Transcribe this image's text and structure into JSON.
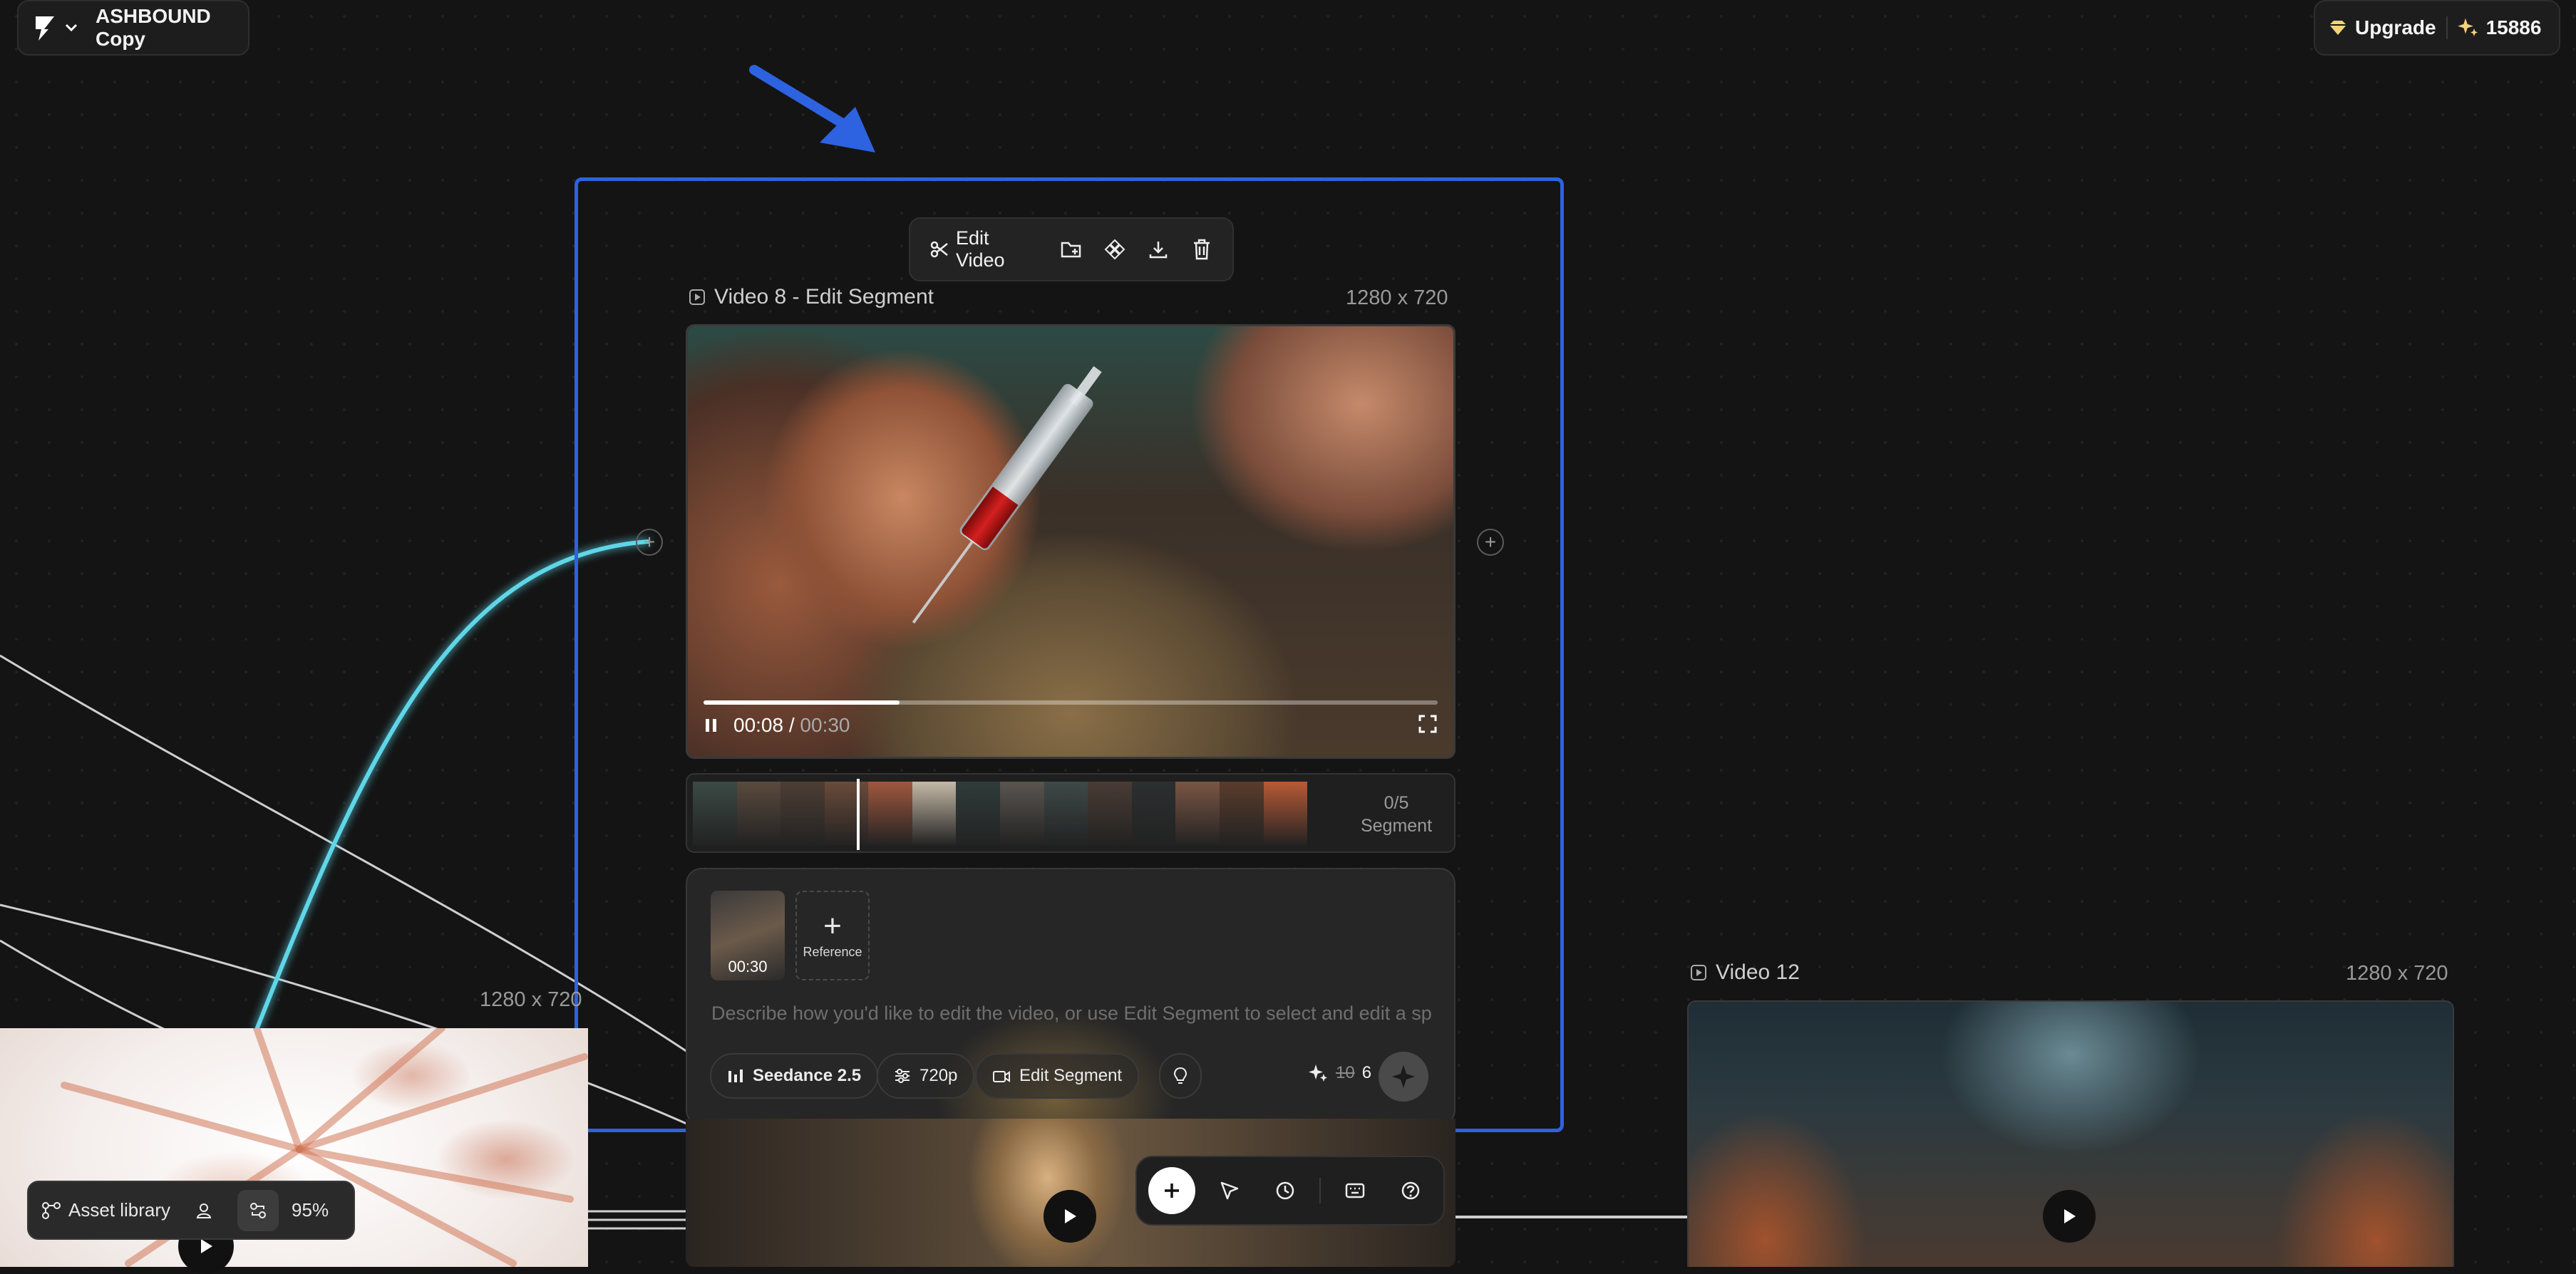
{
  "app": {
    "project_name": "ASHBOUND Copy",
    "upgrade_label": "Upgrade",
    "credits": "15886"
  },
  "node_toolbar": {
    "edit_video_label": "Edit Video",
    "icons": [
      "folder-add-icon",
      "component-icon",
      "download-icon",
      "trash-icon"
    ]
  },
  "selected_node": {
    "title": "Video 8 - Edit Segment",
    "dimensions": "1280 x 720",
    "player": {
      "time_current": "00:08",
      "time_separator": " / ",
      "time_total": "00:30",
      "progress_fraction": 0.267
    },
    "filmstrip": {
      "segment_count": "0/5",
      "segment_label": "Segment",
      "frame_colors": [
        "#3b4a44",
        "#5a4a3e",
        "#4d3e34",
        "#6a4b3a",
        "#a0573e",
        "#c4b9a6",
        "#2f3c3a",
        "#5a5550",
        "#3e4a48",
        "#4a3b34",
        "#2c2f30",
        "#7a5644",
        "#5a3c2c",
        "#b85a36"
      ]
    },
    "prompt_panel": {
      "reference_thumb_time": "00:30",
      "reference_add_label": "Reference",
      "input_placeholder": "Describe how you'd like to edit the video, or use Edit Segment to select and edit a sp...",
      "input_value": "",
      "model_label": "Seedance 2.5",
      "resolution_label": "720p",
      "edit_segment_label": "Edit Segment",
      "cost_original": "10",
      "cost_current": "6"
    }
  },
  "left_node": {
    "dimensions": "1280 x 720"
  },
  "right_node": {
    "title": "Video 12",
    "dimensions": "1280 x 720"
  },
  "bottom_bar": {
    "asset_library_label": "Asset library",
    "zoom": "95%"
  },
  "colors": {
    "selection_border": "#2d63e0",
    "arrow": "#2d63e0",
    "connector_glow": "#5fd6e8",
    "canvas_bg": "#141414"
  }
}
